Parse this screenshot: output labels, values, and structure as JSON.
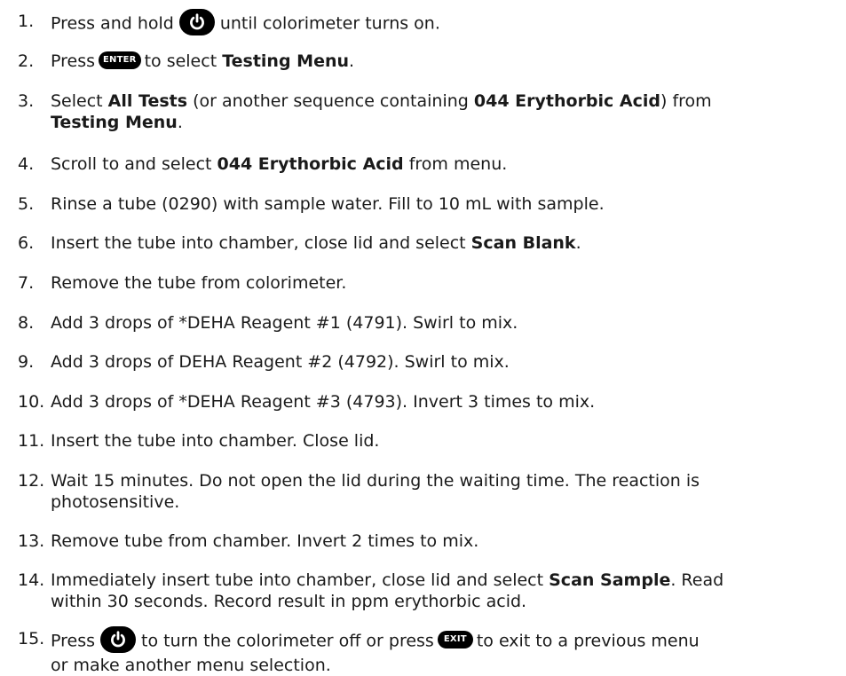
{
  "buttons": {
    "enter_label": "ENTER",
    "exit_label": "EXIT",
    "power_icon": "power-icon"
  },
  "steps": [
    {
      "num": "1.",
      "a": "Press and hold",
      "b": "until colorimeter turns on."
    },
    {
      "num": "2.",
      "a": "Press",
      "b": "to select",
      "c": "Testing Menu",
      "d": "."
    },
    {
      "num": "3.",
      "a": "Select",
      "b": "All Tests",
      "c": "(or another sequence containing",
      "d": "044 Erythorbic Acid",
      "e": ") from",
      "f": "Testing Menu",
      "g": "."
    },
    {
      "num": "4.",
      "a": "Scroll to and select",
      "b": "044 Erythorbic Acid",
      "c": " from menu."
    },
    {
      "num": "5.",
      "a": "Rinse a tube (0290) with sample water. Fill to 10 mL with sample."
    },
    {
      "num": "6.",
      "a": "Insert the tube into chamber, close lid and select",
      "b": "Scan Blank",
      "c": "."
    },
    {
      "num": "7.",
      "a": "Remove the tube from colorimeter."
    },
    {
      "num": "8.",
      "a": "Add 3 drops of *DEHA Reagent #1 (4791). Swirl to mix."
    },
    {
      "num": "9.",
      "a": "Add 3 drops of DEHA Reagent #2 (4792). Swirl to mix."
    },
    {
      "num": "10.",
      "a": "Add 3 drops of *DEHA Reagent #3 (4793). Invert 3 times to mix."
    },
    {
      "num": "11.",
      "a": "Insert the tube into chamber. Close lid."
    },
    {
      "num": "12.",
      "a": "Wait 15 minutes. Do not open the lid during the waiting time. The reaction is",
      "b": "photosensitive."
    },
    {
      "num": "13.",
      "a": "Remove tube from chamber. Invert 2 times to mix."
    },
    {
      "num": "14.",
      "a": "Immediately insert tube into chamber, close lid and select",
      "b": "Scan Sample",
      "c": ". Read",
      "d": "within 30 seconds. Record result in ppm erythorbic acid."
    },
    {
      "num": "15.",
      "a": "Press",
      "b": "to turn the colorimeter off or press",
      "c": "to exit to a previous menu",
      "d": "or make another menu selection."
    }
  ]
}
